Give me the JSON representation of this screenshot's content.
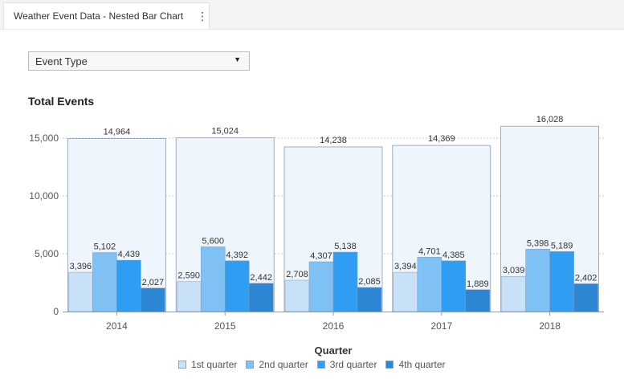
{
  "tab": {
    "title": "Weather Event Data - Nested Bar Chart",
    "menu_icon": "kebab-menu-icon"
  },
  "filter": {
    "selected": "Event Type",
    "caret_icon": "caret-down-icon"
  },
  "colors": {
    "total_fill": "#eef5fd",
    "total_stroke": "#8a9bb0",
    "q1": "#c9e1f7",
    "q2": "#7fc0f5",
    "q3": "#2f9ef2",
    "q4": "#2c86d4",
    "grid": "#c8c8c8",
    "axis": "#999999"
  },
  "chart_data": {
    "type": "bar",
    "title": "Total Events",
    "xlabel": "Quarter",
    "ylabel": "",
    "ylim": [
      0,
      16500
    ],
    "yticks": [
      0,
      5000,
      10000,
      15000
    ],
    "ytick_labels": [
      "0",
      "5,000",
      "10,000",
      "15,000"
    ],
    "grid": true,
    "legend_position": "bottom",
    "categories": [
      "2014",
      "2015",
      "2016",
      "2017",
      "2018"
    ],
    "totals": [
      14964,
      15024,
      14238,
      14369,
      16028
    ],
    "total_labels": [
      "14,964",
      "15,024",
      "14,238",
      "14,369",
      "16,028"
    ],
    "series": [
      {
        "name": "1st quarter",
        "values": [
          3396,
          2590,
          2708,
          3394,
          3039
        ],
        "labels": [
          "3,396",
          "2,590",
          "2,708",
          "3,394",
          "3,039"
        ]
      },
      {
        "name": "2nd quarter",
        "values": [
          5102,
          5600,
          4307,
          4701,
          5398
        ],
        "labels": [
          "5,102",
          "5,600",
          "4,307",
          "4,701",
          "5,398"
        ]
      },
      {
        "name": "3rd quarter",
        "values": [
          4439,
          4392,
          5138,
          4385,
          5189
        ],
        "labels": [
          "4,439",
          "4,392",
          "5,138",
          "4,385",
          "5,189"
        ]
      },
      {
        "name": "4th quarter",
        "values": [
          2027,
          2442,
          2085,
          1889,
          2402
        ],
        "labels": [
          "2,027",
          "2,442",
          "2,085",
          "1,889",
          "2,402"
        ]
      }
    ]
  }
}
